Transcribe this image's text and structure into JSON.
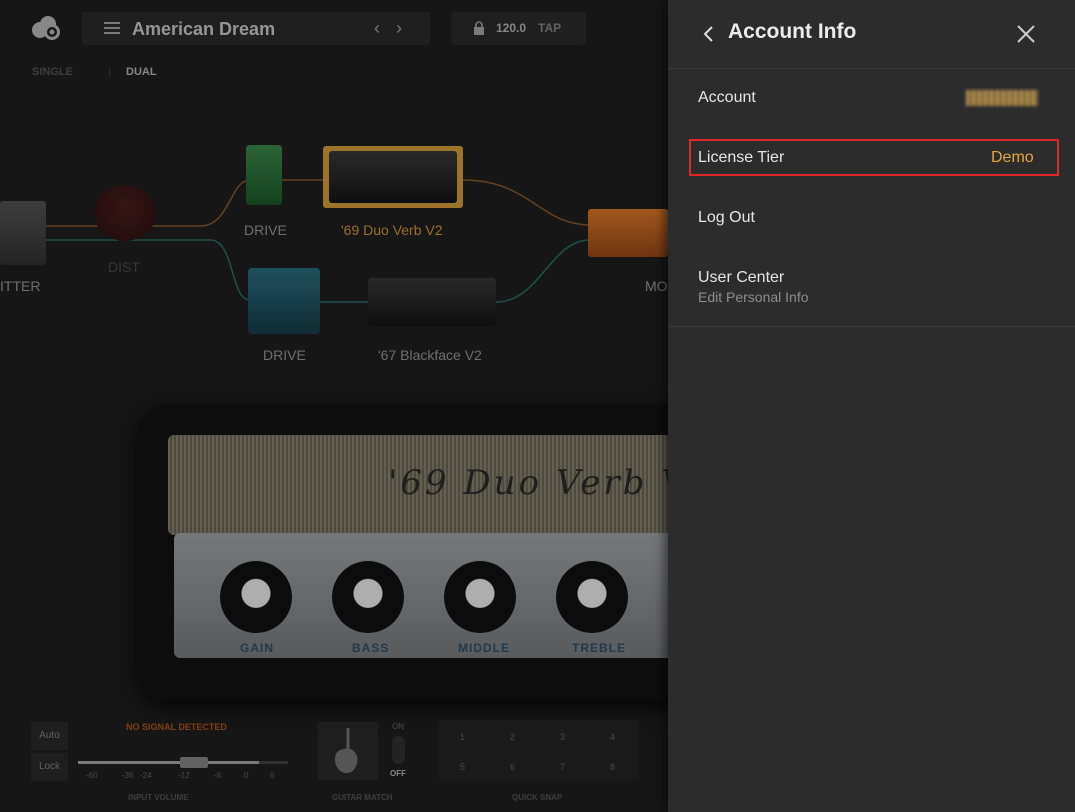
{
  "preset": {
    "name": "American Dream",
    "prev_icon": "chevron-left-icon",
    "next_icon": "chevron-right-icon"
  },
  "tempo": {
    "bpm": "120.0",
    "tap_label": "TAP"
  },
  "routing": {
    "single_label": "SINGLE",
    "dual_label": "DUAL",
    "selected": "DUAL"
  },
  "chain": {
    "splitter_label": "ITTER",
    "dist_label": "DIST",
    "drive_top_label": "DRIVE",
    "amp_top_label": "'69 Duo Verb V2",
    "drive_bottom_label": "DRIVE",
    "amp_bottom_label": "'67 Blackface V2",
    "mod_label": "MO"
  },
  "amp": {
    "script_name": "'69 Duo Verb V",
    "knob_labels": [
      "GAIN",
      "BASS",
      "MIDDLE",
      "TREBLE"
    ]
  },
  "input": {
    "auto_label": "Auto",
    "lock_label": "Lock",
    "no_signal": "NO SIGNAL DETECTED",
    "ticks": [
      "-60",
      "-36",
      "-24",
      "-12",
      "-6",
      "0",
      "6"
    ],
    "level_fraction": 0.86,
    "title": "INPUT VOLUME"
  },
  "guitar_match": {
    "on_label": "ON",
    "off_label": "OFF",
    "title": "GUITAR MATCH"
  },
  "quick_snap": {
    "slots": [
      "1",
      "2",
      "3",
      "4",
      "5",
      "6",
      "7",
      "8"
    ],
    "title": "QUICK SNAP"
  },
  "account_panel": {
    "title": "Account Info",
    "rows": {
      "account": {
        "label": "Account"
      },
      "license": {
        "label": "License Tier",
        "value": "Demo"
      },
      "logout": {
        "label": "Log Out"
      },
      "user_center": {
        "label": "User Center",
        "sublabel": "Edit Personal Info"
      }
    }
  },
  "colors": {
    "accent_orange": "#e6a63c",
    "highlight_red": "#e0262b",
    "panel_bg": "#2c2c2c"
  }
}
